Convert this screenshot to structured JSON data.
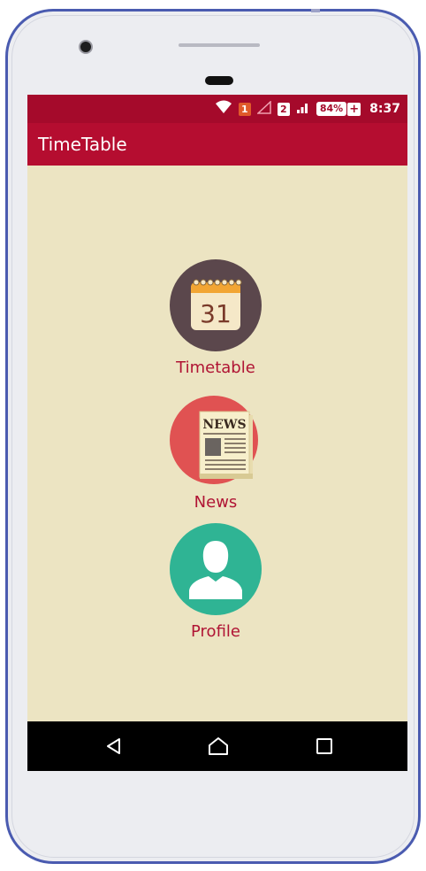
{
  "statusbar": {
    "sim1": "1",
    "sim2": "2",
    "battery": "84%",
    "time": "8:37"
  },
  "appbar": {
    "title": "TimeTable"
  },
  "menu": {
    "timetable": {
      "label": "Timetable",
      "calendar_day": "31",
      "icon": "calendar-icon"
    },
    "news": {
      "label": "News",
      "headline": "NEWS",
      "icon": "newspaper-icon"
    },
    "profile": {
      "label": "Profile",
      "icon": "user-icon"
    }
  },
  "colors": {
    "statusbar": "#a50a2b",
    "appbar": "#b50d30",
    "background": "#ece4c2",
    "label": "#b01434",
    "timetable_circle": "#5b474c",
    "news_circle": "#e05252",
    "profile_circle": "#2fb494"
  },
  "navbar": {
    "back_icon": "back-triangle-icon",
    "home_icon": "home-icon",
    "recents_icon": "recents-square-icon"
  }
}
